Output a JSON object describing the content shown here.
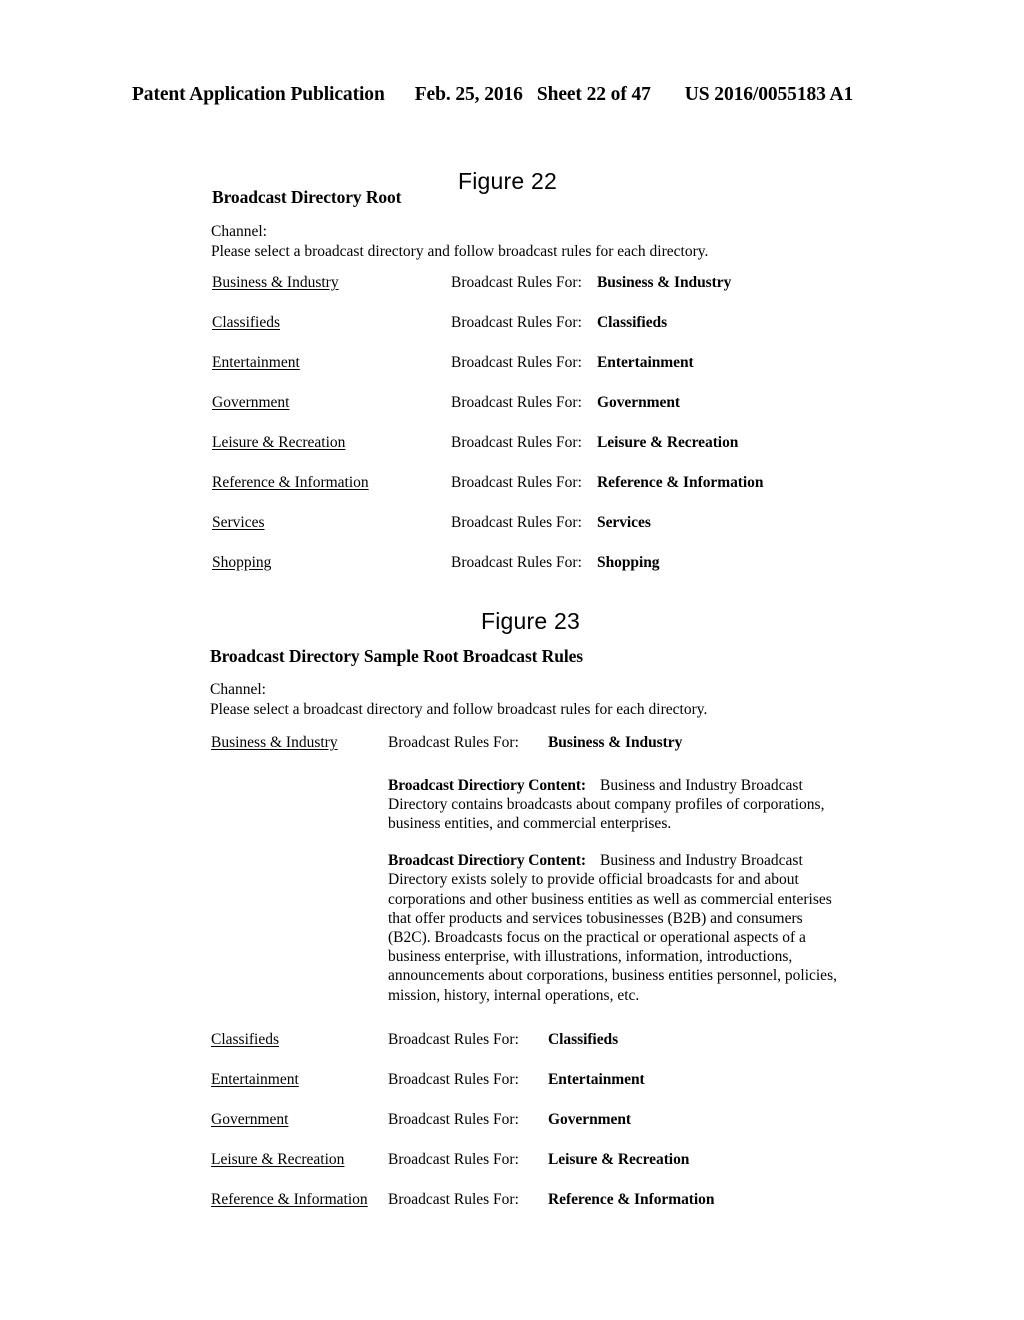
{
  "header": {
    "publication": "Patent Application Publication",
    "date": "Feb. 25, 2016",
    "sheet": "Sheet 22 of 47",
    "number": "US 2016/0055183 A1"
  },
  "figure22": {
    "caption": "Figure 22",
    "heading": "Broadcast Directory Root",
    "channel_label": "Channel:",
    "channel_text": "Please select a broadcast directory and follow broadcast rules for each directory.",
    "rules_label": "Broadcast Rules For:",
    "rows": [
      {
        "link": "Business & Industry",
        "label": "Broadcast Rules For:",
        "value": "Business & Industry"
      },
      {
        "link": "Classifieds",
        "label": "Broadcast Rules For:",
        "value": "Classifieds"
      },
      {
        "link": "Entertainment",
        "label": "Broadcast Rules For:",
        "value": "Entertainment"
      },
      {
        "link": "Government",
        "label": "Broadcast Rules For:",
        "value": "Government"
      },
      {
        "link": "Leisure & Recreation",
        "label": "Broadcast Rules For:",
        "value": "Leisure & Recreation"
      },
      {
        "link": "Reference & Information",
        "label": "Broadcast Rules For:",
        "value": "Reference & Information"
      },
      {
        "link": "Services",
        "label": "Broadcast Rules For:",
        "value": "Services"
      },
      {
        "link": "Shopping",
        "label": "Broadcast Rules For:",
        "value": "Shopping"
      }
    ]
  },
  "figure23": {
    "caption": "Figure 23",
    "heading": "Broadcast Directory Sample Root Broadcast Rules",
    "channel_label": "Channel:",
    "channel_text": "Please select a broadcast directory and follow broadcast rules for each directory.",
    "rows": [
      {
        "link": "Business & Industry",
        "label": "Broadcast Rules For:",
        "value": "Business & Industry"
      },
      {
        "link": "Classifieds",
        "label": "Broadcast Rules For:",
        "value": "Classifieds"
      },
      {
        "link": "Entertainment",
        "label": "Broadcast Rules For:",
        "value": "Entertainment"
      },
      {
        "link": "Government",
        "label": "Broadcast Rules For:",
        "value": "Government"
      },
      {
        "link": "Leisure & Recreation",
        "label": "Broadcast Rules For:",
        "value": "Leisure & Recreation"
      },
      {
        "link": "Reference & Information",
        "label": "Broadcast Rules For:",
        "value": "Reference & Information"
      }
    ],
    "content_blocks": [
      {
        "label": "Broadcast Directiory Content:",
        "body": "Business and Industry Broadcast Directory contains broadcasts about company profiles of corporations, business entities, and commercial enterprises."
      },
      {
        "label": "Broadcast Directiory Content:",
        "body": "Business and Industry Broadcast Directory exists solely to provide official broadcasts for and about corporations and other business entities as well as commercial enterises that offer products and services tobusinesses (B2B) and consumers (B2C).  Broadcasts focus on the practical or operational aspects of a business enterprise, with illustrations, information, introductions, announcements about corporations, business entities personnel, policies, mission, history, internal operations, etc."
      }
    ]
  }
}
